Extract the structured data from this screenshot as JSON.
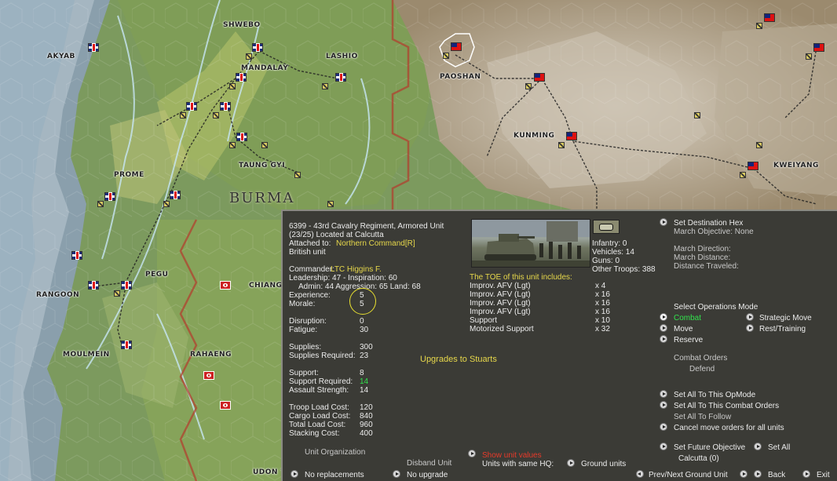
{
  "map": {
    "cities": [
      "AKYAB",
      "SHWEBO",
      "LASHIO",
      "MANDALAY",
      "PAOSHAN",
      "KUNMING",
      "KWEIYANG",
      "PROME",
      "TAUNG GYI",
      "RANGOON",
      "PEGU",
      "CHIANG",
      "MOULMEIN",
      "RAHAENG",
      "UDON T"
    ],
    "region_label": "BURMA"
  },
  "unit": {
    "title": "6399 - 43rd Cavalry Regiment, Armored Unit",
    "location": "(23/25) Located at  Calcutta",
    "attached_prefix": "Attached to:",
    "attached_value": "Northern Command[R]",
    "nationality": "British unit",
    "commander_prefix": "Commander:",
    "commander_value": "LTC Higgins F.",
    "leadership": "Leadership: 47 - Inspiration: 60",
    "admin": "Admin: 44  Aggression: 65 Land: 68",
    "stats": [
      {
        "label": "Experience:",
        "value": "5"
      },
      {
        "label": "Morale:",
        "value": "5"
      },
      {
        "label": "Disruption:",
        "value": "0"
      },
      {
        "label": "Fatigue:",
        "value": "30"
      },
      {
        "label": "Supplies:",
        "value": "300"
      },
      {
        "label": "Supplies Required:",
        "value": "23"
      },
      {
        "label": "Support:",
        "value": "8"
      },
      {
        "label": "Support Required:",
        "value": "14"
      },
      {
        "label": "Assault Strength:",
        "value": "14"
      },
      {
        "label": "Troop Load Cost:",
        "value": "120"
      },
      {
        "label": "Cargo Load Cost:",
        "value": "840"
      },
      {
        "label": "Total Load Cost:",
        "value": "960"
      },
      {
        "label": "Stacking Cost:",
        "value": "400"
      }
    ]
  },
  "troops": {
    "infantry": "Infantry: 0",
    "vehicles": "Vehicles: 14",
    "guns": "Guns: 0",
    "other": "Other Troops: 388"
  },
  "toe": {
    "heading": "The TOE of this unit includes:",
    "items": [
      {
        "name": "Improv. AFV (Lgt)",
        "count": "x 4"
      },
      {
        "name": "Improv. AFV (Lgt)",
        "count": "x 16"
      },
      {
        "name": "Improv. AFV (Lgt)",
        "count": "x 16"
      },
      {
        "name": "Improv. AFV (Lgt)",
        "count": "x 16"
      },
      {
        "name": "Support",
        "count": "x 10"
      },
      {
        "name": "Motorized Support",
        "count": "x 32"
      }
    ],
    "upgrade_note": "Upgrades to Stuarts"
  },
  "right": {
    "set_destination": "Set Destination Hex",
    "march_objective": "March Objective: None",
    "march_direction": "March Direction:",
    "march_distance": "March Distance:",
    "distance_traveled": "Distance Traveled:",
    "ops_mode_heading": "Select Operations Mode",
    "combat": "Combat",
    "move": "Move",
    "reserve": "Reserve",
    "strategic_move": "Strategic Move",
    "rest_training": "Rest/Training",
    "combat_orders": "Combat Orders",
    "defend": "Defend",
    "set_all_opmode": "Set All To This OpMode",
    "set_all_combat": "Set All To This Combat Orders",
    "set_all_follow": "Set All To Follow",
    "cancel_move": "Cancel move orders for all units",
    "set_future_objective": "Set Future Objective",
    "future_value": "Calcutta (0)",
    "set_all": "Set All"
  },
  "bottom": {
    "unit_organization": "Unit Organization",
    "disband_unit": "Disband Unit",
    "show_unit_values": "Show unit values",
    "units_same_hq": "Units with same HQ:",
    "ground_units": "Ground units",
    "no_replacements": "No replacements",
    "no_upgrade": "No upgrade",
    "prev_next": "Prev/Next Ground Unit",
    "back": "Back",
    "exit": "Exit"
  },
  "colors": {
    "highlight": "#e7d84b",
    "active": "#31e34c",
    "warning": "#e83a2a"
  }
}
